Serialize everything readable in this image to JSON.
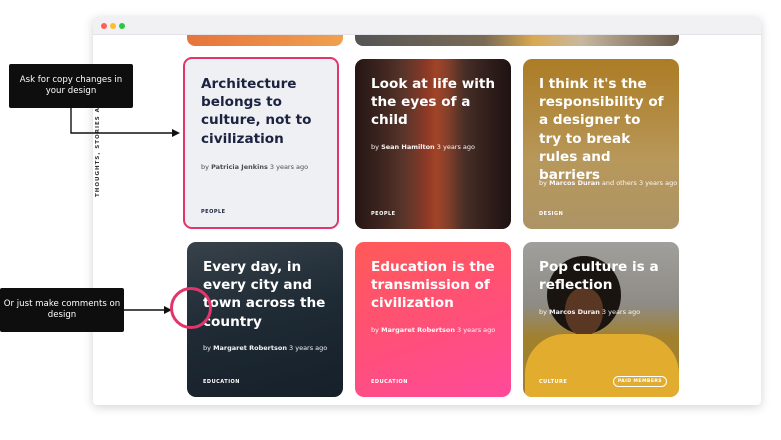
{
  "side_label": "THOUGHTS, STORIES AND IDEAS",
  "annotations": [
    {
      "text": "Ask for copy changes in your design"
    },
    {
      "text": "Or just make comments on design"
    }
  ],
  "cards": [
    {
      "title": "Architecture belongs to culture, not to civilization",
      "by": "by",
      "author": "Patricia Jenkins",
      "ago": "3 years ago",
      "tag": "PEOPLE"
    },
    {
      "title": "Look at life with the eyes of a child",
      "by": "by",
      "author": "Sean Hamilton",
      "ago": "3 years ago",
      "tag": "PEOPLE"
    },
    {
      "title": "I think it's the responsibility of a designer to try to break rules and barriers",
      "by": "by",
      "author": "Marcos Duran",
      "ago": "and others 3 years ago",
      "tag": "DESIGN"
    },
    {
      "title": "Every day, in every city and town across the country",
      "by": "by",
      "author": "Margaret Robertson",
      "ago": "3 years ago",
      "tag": "EDUCATION"
    },
    {
      "title": "Education is the transmission of civilization",
      "by": "by",
      "author": "Margaret Robertson",
      "ago": "3 years ago",
      "tag": "EDUCATION"
    },
    {
      "title": "Pop culture is a reflection",
      "by": "by",
      "author": "Marcos Duran",
      "ago": "3 years ago",
      "tag": "CULTURE",
      "badge": "PAID MEMBERS"
    }
  ],
  "colors": {
    "highlight": "#e1356c"
  }
}
